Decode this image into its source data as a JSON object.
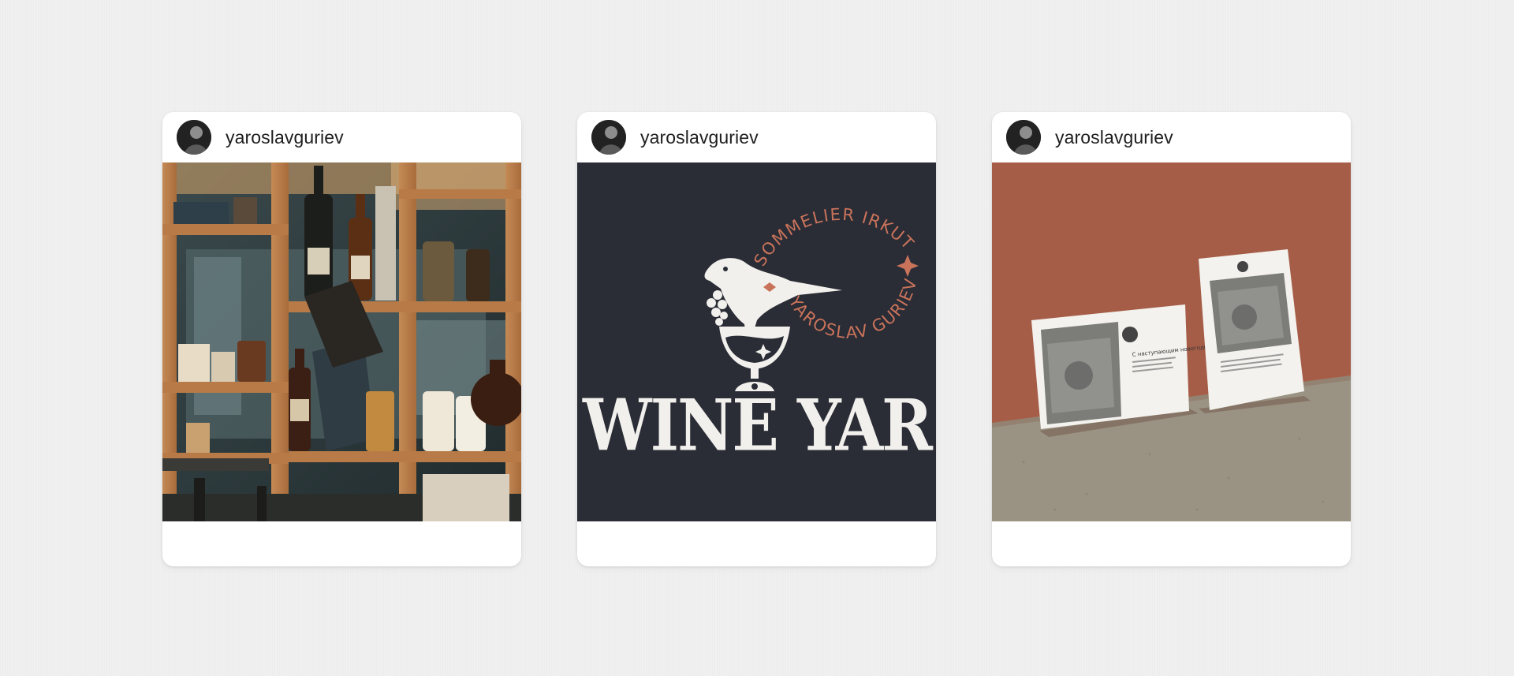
{
  "posts": [
    {
      "username": "yaroslavguriev",
      "image": {
        "kind": "photo",
        "subject": "wine-shelves"
      }
    },
    {
      "username": "yaroslavguriev",
      "image": {
        "kind": "logo",
        "arc_top": "SOMMELIER IRKUTSK",
        "arc_bottom": "YAROSLAV GURIEV",
        "wordmark": "WINE YAR",
        "background": "#2a2c36",
        "accent": "#c9735a"
      }
    },
    {
      "username": "yaroslavguriev",
      "image": {
        "kind": "mockup",
        "wall_color": "#a65d47",
        "floor_color": "#9a9383",
        "card_heading": "С наступающим новогодним праздником!"
      }
    }
  ],
  "colors": {
    "page_background": "#f0f0f0",
    "card_background": "#ffffff",
    "username_text": "#1e1e1e"
  }
}
